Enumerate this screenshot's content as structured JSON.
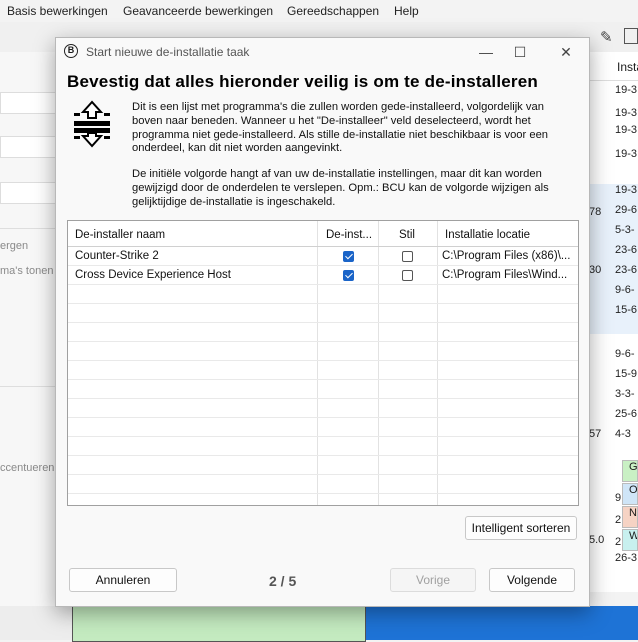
{
  "background": {
    "menu": [
      "Basis bewerkingen",
      "Geavanceerde bewerkingen",
      "Gereedschappen",
      "Help"
    ],
    "sidebar_texts": [
      "ergen",
      "ma's tonen",
      "ccentueren"
    ],
    "column_header": "Instal",
    "dates": [
      "19-3",
      "19-3",
      "19-3",
      "19-3",
      "19-3",
      "29-6",
      "5-3-",
      "23-6",
      "23-6",
      "9-6-",
      "15-6",
      "9-6-",
      "15-9",
      "3-3-",
      "25-6",
      "4-3",
      "9",
      "2",
      "2",
      "26-3"
    ],
    "left_numbers": [
      "78",
      "30",
      "57",
      "5.0"
    ],
    "legend": [
      {
        "letter": "G",
        "color": "#c9f0c4"
      },
      {
        "letter": "O",
        "color": "#cfe5f7"
      },
      {
        "letter": "N",
        "color": "#f6d3c4"
      },
      {
        "letter": "W",
        "color": "#c8f0ef"
      }
    ]
  },
  "dialog": {
    "title": "Start nieuwe de-installatie taak",
    "heading": "Bevestig dat alles hieronder veilig is om te de-installeren",
    "paragraph1": "Dit is een lijst met programma's die zullen worden gede-installeerd, volgordelijk van boven naar beneden. Wanneer u het \"De-installeer\" veld deselecteerd, wordt het programma niet gede-installeerd. Als stille de-installatie niet beschikbaar is voor een onderdeel, kan dit niet worden aangevinkt.",
    "paragraph2": "De initiële volgorde hangt af van uw de-installatie instellingen, maar dit kan worden gewijzigd door de onderdelen te verslepen. Opm.: BCU kan de volgorde wijzigen als gelijktijdige de-installatie is ingeschakeld.",
    "columns": [
      "De-installer naam",
      "De-inst...",
      "Stil",
      "Installatie locatie"
    ],
    "rows": [
      {
        "name": "Counter-Strike 2",
        "uninstall": true,
        "silent": false,
        "location": "C:\\Program Files (x86)\\..."
      },
      {
        "name": "Cross Device Experience Host",
        "uninstall": true,
        "silent": false,
        "location": "C:\\Program Files\\Wind..."
      }
    ],
    "smart_sort": "Intelligent sorteren",
    "cancel": "Annuleren",
    "page_indicator": "2 / 5",
    "previous": "Vorige",
    "next": "Volgende"
  }
}
